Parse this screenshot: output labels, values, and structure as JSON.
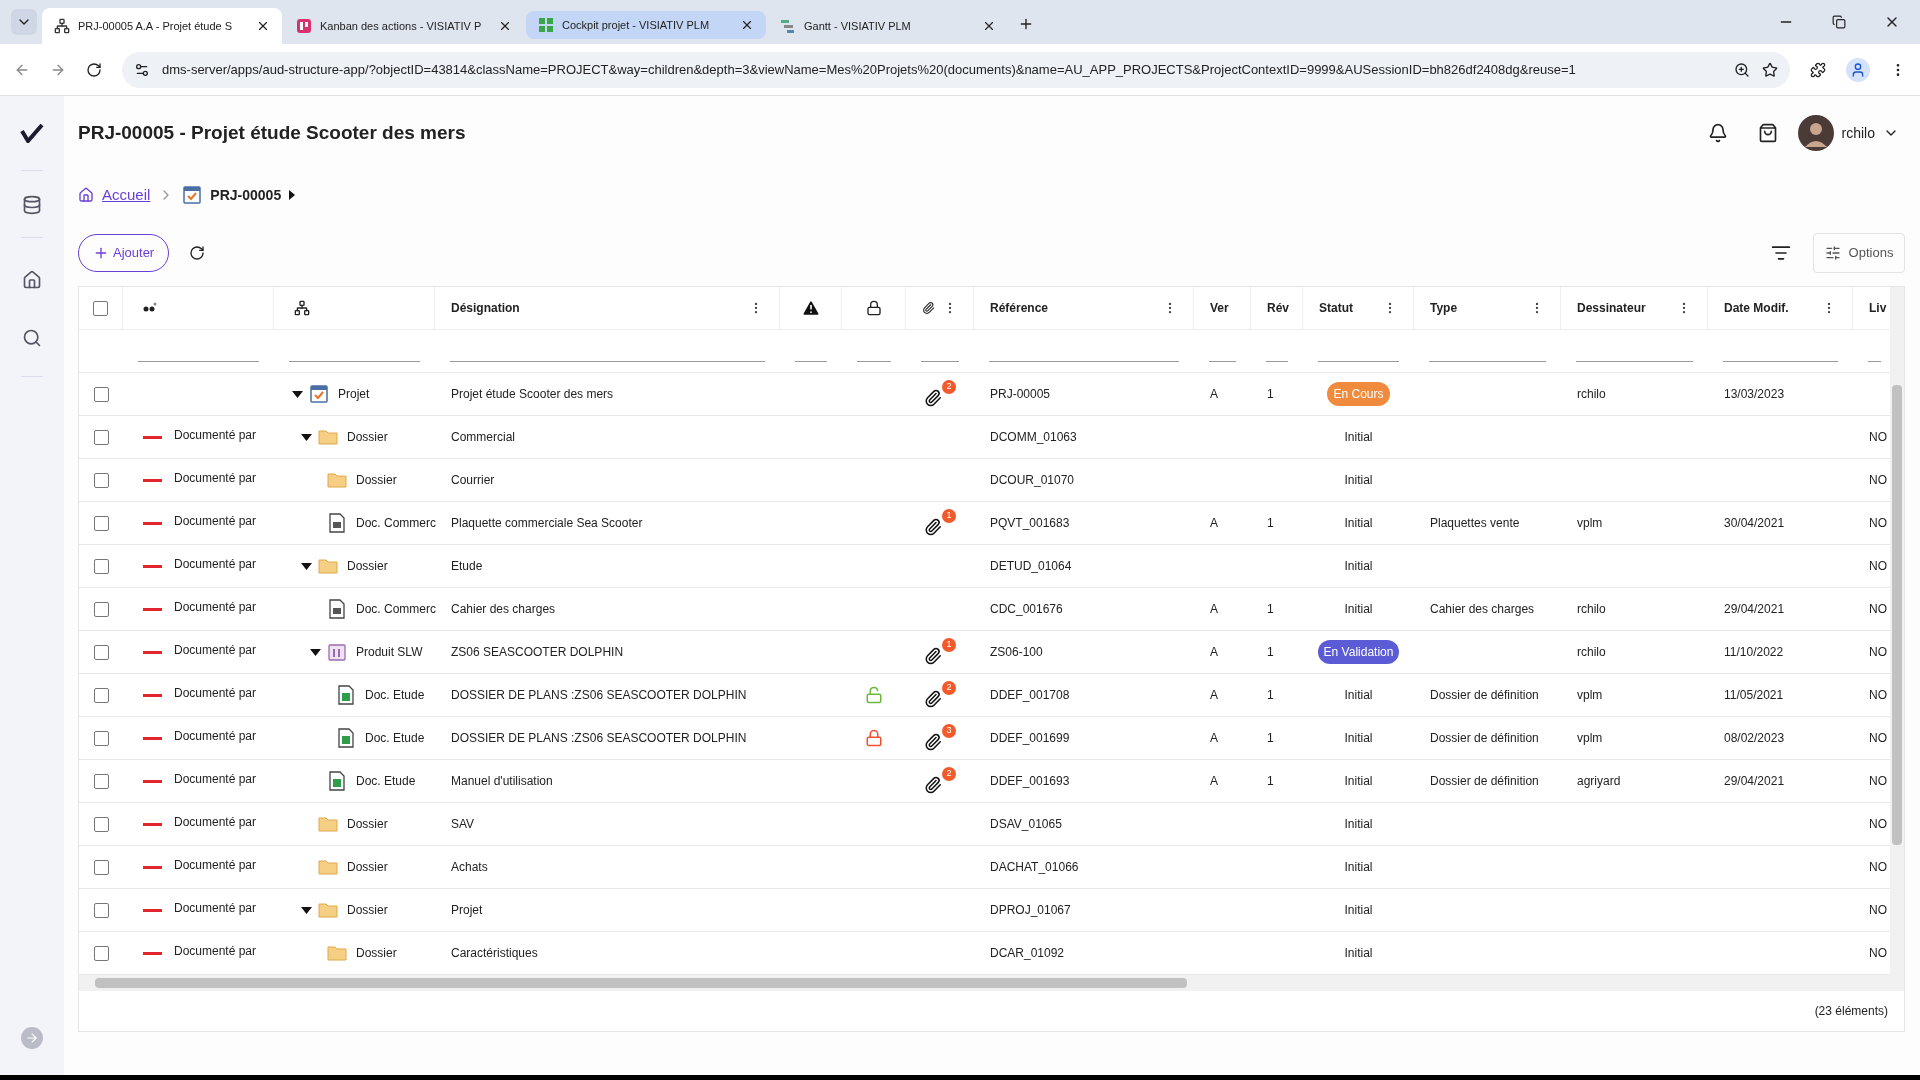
{
  "browser": {
    "tabs": [
      {
        "title": "PRJ-00005 A.A - Projet étude S",
        "selected": true,
        "highlighted": false
      },
      {
        "title": "Kanban des actions - VISIATIV P",
        "selected": false,
        "highlighted": false
      },
      {
        "title": "Cockpit projet - VISIATIV PLM",
        "selected": false,
        "highlighted": true
      },
      {
        "title": "Gantt - VISIATIV PLM",
        "selected": false,
        "highlighted": false
      }
    ],
    "url": "dms-server/apps/aud-structure-app/?objectID=43814&className=PROJECT&way=children&depth=3&viewName=Mes%20Projets%20(documents)&name=AU_APP_PROJECTS&ProjectContextID=9999&AUSessionID=bh826df2408dg&reuse=1"
  },
  "header": {
    "title": "PRJ-00005 - Projet étude Scooter des mers",
    "user": "rchilo"
  },
  "breadcrumb": [
    {
      "label": "Accueil"
    },
    {
      "label": "PRJ-00005"
    }
  ],
  "toolbar": {
    "add": "Ajouter",
    "options": "Options"
  },
  "table": {
    "select_all": {
      "checked": false
    },
    "columns": [
      "Désignation",
      "Référence",
      "Ver",
      "Rév",
      "Statut",
      "Type",
      "Dessinateur",
      "Date Modif.",
      "Liv"
    ],
    "rows": [
      {
        "checked": false,
        "kind": "project",
        "type": "Projet",
        "designation": "Projet étude Scooter des mers",
        "attachments": "2",
        "reference": "PRJ-00005",
        "ver": "A",
        "rev": "1",
        "status": {
          "text": "En Cours",
          "color": "#f08a3c"
        },
        "designer": "rchilo",
        "date": "13/03/2023",
        "expanded": true,
        "children": [
          {
            "checked": false,
            "link": "Documenté par",
            "kind": "folder",
            "type": "Dossier",
            "designation": "Commercial",
            "reference": "DCOMM_01063",
            "status": {
              "text": "Initial"
            },
            "liv": "NO",
            "expanded": true,
            "children": [
              {
                "checked": false,
                "link": "Documenté par",
                "kind": "folder",
                "type": "Dossier",
                "designation": "Courrier",
                "reference": "DCOUR_01070",
                "status": {
                  "text": "Initial"
                },
                "liv": "NO"
              },
              {
                "checked": false,
                "link": "Documenté par",
                "kind": "doc",
                "type": "Doc. Commerc",
                "designation": "Plaquette commerciale Sea Scooter",
                "attachments": "1",
                "reference": "PQVT_001683",
                "ver": "A",
                "rev": "1",
                "status": {
                  "text": "Initial"
                },
                "doc_type": "Plaquettes vente",
                "designer": "vplm",
                "date": "30/04/2021",
                "liv": "NO"
              }
            ]
          },
          {
            "checked": false,
            "link": "Documenté par",
            "kind": "folder",
            "type": "Dossier",
            "designation": "Etude",
            "reference": "DETUD_01064",
            "status": {
              "text": "Initial"
            },
            "liv": "NO",
            "expanded": true,
            "children": [
              {
                "checked": false,
                "link": "Documenté par",
                "kind": "doc",
                "type": "Doc. Commerc",
                "designation": "Cahier des charges",
                "reference": "CDC_001676",
                "ver": "A",
                "rev": "1",
                "status": {
                  "text": "Initial"
                },
                "doc_type": "Cahier des charges",
                "designer": "rchilo",
                "date": "29/04/2021",
                "liv": "NO"
              },
              {
                "checked": false,
                "link": "Documenté par",
                "kind": "product",
                "type": "Produit SLW",
                "designation": "ZS06 SEASCOOTER DOLPHIN",
                "attachments": "1",
                "reference": "ZS06-100",
                "ver": "A",
                "rev": "1",
                "status": {
                  "text": "En Validation",
                  "color": "#5b5bd6"
                },
                "designer": "rchilo",
                "date": "11/10/2022",
                "liv": "NO",
                "expanded": true,
                "children": [
                  {
                    "checked": false,
                    "link": "Documenté par",
                    "kind": "study",
                    "type": "Doc. Etude",
                    "designation": "DOSSIER DE PLANS :ZS06 SEASCOOTER DOLPHIN",
                    "locked": false,
                    "attachments": "2",
                    "reference": "DDEF_001708",
                    "ver": "A",
                    "rev": "1",
                    "status": {
                      "text": "Initial"
                    },
                    "doc_type": "Dossier de définition",
                    "designer": "vplm",
                    "date": "11/05/2021",
                    "liv": "NO"
                  },
                  {
                    "checked": false,
                    "link": "Documenté par",
                    "kind": "study",
                    "type": "Doc. Etude",
                    "designation": "DOSSIER DE PLANS :ZS06 SEASCOOTER DOLPHIN",
                    "locked": true,
                    "attachments": "3",
                    "reference": "DDEF_001699",
                    "ver": "A",
                    "rev": "1",
                    "status": {
                      "text": "Initial"
                    },
                    "doc_type": "Dossier de définition",
                    "designer": "vplm",
                    "date": "08/02/2023",
                    "liv": "NO"
                  }
                ]
              },
              {
                "checked": false,
                "link": "Documenté par",
                "kind": "study",
                "type": "Doc. Etude",
                "designation": "Manuel d'utilisation",
                "attachments": "2",
                "reference": "DDEF_001693",
                "ver": "A",
                "rev": "1",
                "status": {
                  "text": "Initial"
                },
                "doc_type": "Dossier de définition",
                "designer": "agriyard",
                "date": "29/04/2021",
                "liv": "NO"
              }
            ]
          },
          {
            "checked": false,
            "link": "Documenté par",
            "kind": "folder",
            "type": "Dossier",
            "designation": "SAV",
            "reference": "DSAV_01065",
            "status": {
              "text": "Initial"
            },
            "liv": "NO"
          },
          {
            "checked": false,
            "link": "Documenté par",
            "kind": "folder",
            "type": "Dossier",
            "designation": "Achats",
            "reference": "DACHAT_01066",
            "status": {
              "text": "Initial"
            },
            "liv": "NO"
          },
          {
            "checked": false,
            "link": "Documenté par",
            "kind": "folder",
            "type": "Dossier",
            "designation": "Projet",
            "reference": "DPROJ_01067",
            "status": {
              "text": "Initial"
            },
            "liv": "NO",
            "expanded": true,
            "children": [
              {
                "checked": false,
                "link": "Documenté par",
                "kind": "folder",
                "type": "Dossier",
                "designation": "Caractéristiques",
                "reference": "DCAR_01092",
                "status": {
                  "text": "Initial"
                },
                "liv": "NO"
              }
            ]
          }
        ]
      }
    ]
  },
  "footer": "(23 éléments)"
}
